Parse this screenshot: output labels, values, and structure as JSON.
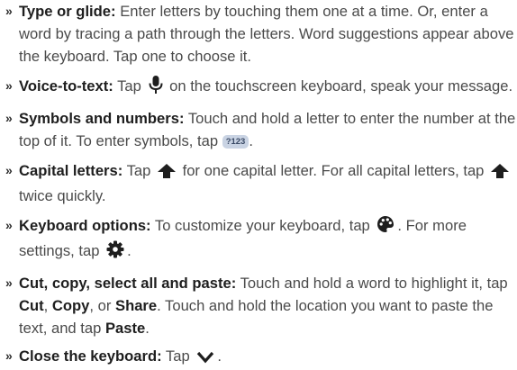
{
  "items": [
    {
      "term": "Type or glide:",
      "text": "Enter letters by touching them one at a time. Or, enter a word by tracing a path through the letters. Word suggestions appear above the keyboard. Tap one to choose it."
    },
    {
      "term": "Voice-to-text:",
      "pre": "Tap",
      "icon": "microphone-icon",
      "post": "on the touchscreen keyboard, speak your message."
    },
    {
      "term": "Symbols and numbers:",
      "pre": "Touch and hold a letter to enter the number at the top of it. To enter symbols, tap",
      "key": "?123",
      "post": "."
    },
    {
      "term": "Capital letters:",
      "pre": "Tap",
      "icon": "shift-arrow-icon",
      "mid": "for one capital letter. For all capital letters, tap",
      "post": "twice quickly."
    },
    {
      "term": "Keyboard options:",
      "pre": "To customize your keyboard, tap",
      "icon": "palette-icon",
      "mid": ". For more settings, tap",
      "icon2": "gear-icon",
      "post": "."
    },
    {
      "term": "Cut, copy, select all and paste:",
      "t1": "Touch and hold a word to highlight it, tap",
      "b1": "Cut",
      "s1": ",",
      "b2": "Copy",
      "s2": ", or",
      "b3": "Share",
      "t2": ". Touch and hold the location you want to paste the text, and tap",
      "b4": "Paste",
      "t3": "."
    },
    {
      "term": "Close the keyboard:",
      "pre": "Tap",
      "icon": "chevron-down-icon",
      "post": "."
    }
  ],
  "bullet": "»"
}
